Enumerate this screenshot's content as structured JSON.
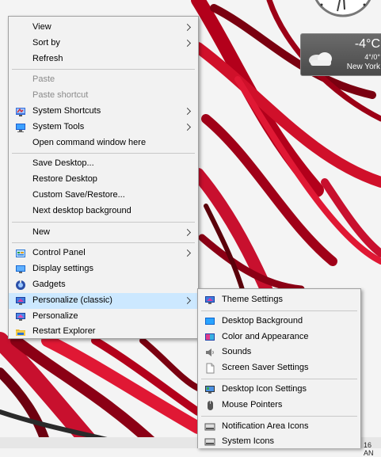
{
  "context_menu": {
    "items": [
      {
        "label": "View",
        "submenu": true
      },
      {
        "label": "Sort by",
        "submenu": true
      },
      {
        "label": "Refresh"
      },
      {
        "label": "Paste",
        "disabled": true
      },
      {
        "label": "Paste shortcut",
        "disabled": true
      },
      {
        "label": "System Shortcuts",
        "submenu": true,
        "icon": "system-shortcuts-icon"
      },
      {
        "label": "System Tools",
        "submenu": true,
        "icon": "monitor-icon"
      },
      {
        "label": "Open command window here"
      },
      {
        "label": "Save Desktop..."
      },
      {
        "label": "Restore Desktop"
      },
      {
        "label": "Custom Save/Restore..."
      },
      {
        "label": "Next desktop background"
      },
      {
        "label": "New",
        "submenu": true
      },
      {
        "label": "Control Panel",
        "submenu": true,
        "icon": "control-panel-icon"
      },
      {
        "label": "Display settings",
        "icon": "display-settings-icon"
      },
      {
        "label": "Gadgets",
        "icon": "gadgets-icon"
      },
      {
        "label": "Personalize (classic)",
        "submenu": true,
        "icon": "personalize-classic-icon",
        "highlighted": true
      },
      {
        "label": "Personalize",
        "icon": "personalize-icon"
      },
      {
        "label": "Restart Explorer",
        "icon": "explorer-folder-icon"
      }
    ]
  },
  "submenu": {
    "items": [
      {
        "label": "Theme Settings",
        "icon": "theme-settings-icon"
      },
      {
        "label": "Desktop Background",
        "icon": "desktop-background-icon"
      },
      {
        "label": "Color and Appearance",
        "icon": "color-appearance-icon"
      },
      {
        "label": "Sounds",
        "icon": "speaker-icon"
      },
      {
        "label": "Screen Saver Settings",
        "icon": "screen-saver-icon"
      },
      {
        "label": "Desktop Icon Settings",
        "icon": "desktop-icon-settings-icon"
      },
      {
        "label": "Mouse Pointers",
        "icon": "mouse-icon"
      },
      {
        "label": "Notification Area Icons",
        "icon": "notification-area-icon"
      },
      {
        "label": "System Icons",
        "icon": "system-icons-icon"
      }
    ]
  },
  "weather": {
    "temperature": "-4°C",
    "range": "4°/0°",
    "city": "New York"
  },
  "taskbar": {
    "time_fragment": "16 AN"
  },
  "colors": {
    "highlight": "#cce8ff",
    "menu_bg": "#f2f2f2",
    "wallpaper_red": "#c8102e"
  }
}
